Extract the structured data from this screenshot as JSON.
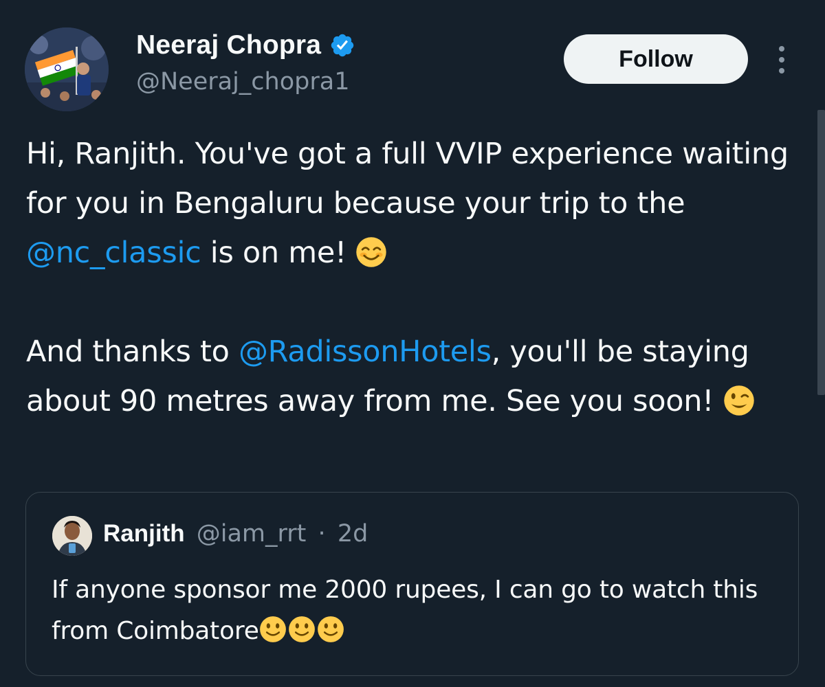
{
  "author": {
    "display_name": "Neeraj Chopra",
    "handle": "@Neeraj_chopra1",
    "verified": true
  },
  "actions": {
    "follow_label": "Follow"
  },
  "tweet": {
    "p1_part1": "Hi, Ranjith. You've got a full VVIP experience waiting for you in Bengaluru because your trip to the ",
    "p1_mention": "@nc_classic",
    "p1_part2": " is on me! ",
    "p1_emoji": "smiling-face-icon",
    "p2_part1": "And thanks to ",
    "p2_mention": "@RadissonHotels",
    "p2_part2": ", you'll be staying about 90 metres away from me. See you soon! ",
    "p2_emoji": "winking-face-icon"
  },
  "quoted_tweet": {
    "display_name": "Ranjith",
    "handle": "@iam_rrt",
    "separator": "·",
    "time": "2d",
    "text": "If anyone sponsor me 2000 rupees, I can go to watch this from Coimbatore",
    "emojis": [
      "slightly-smiling-face-icon",
      "slightly-smiling-face-icon",
      "slightly-smiling-face-icon"
    ]
  },
  "colors": {
    "background": "#15202b",
    "mention": "#1d9bf0",
    "secondary_text": "#8b98a5",
    "verified_badge": "#1d9bf0",
    "follow_button_bg": "#eff3f4"
  }
}
